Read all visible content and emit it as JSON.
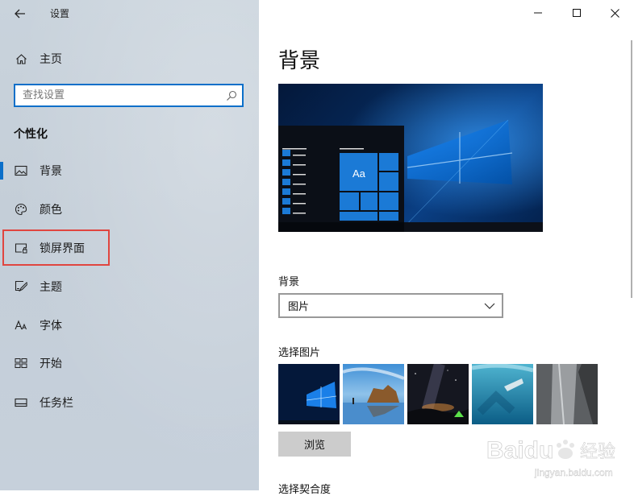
{
  "window": {
    "title": "设置"
  },
  "sidebar": {
    "home_label": "主页",
    "search_placeholder": "查找设置",
    "section_title": "个性化",
    "items": [
      {
        "label": "背景",
        "icon": "picture-icon",
        "selected": true
      },
      {
        "label": "颜色",
        "icon": "palette-icon"
      },
      {
        "label": "锁屏界面",
        "icon": "lock-screen-icon",
        "highlighted": true
      },
      {
        "label": "主题",
        "icon": "theme-icon"
      },
      {
        "label": "字体",
        "icon": "font-icon"
      },
      {
        "label": "开始",
        "icon": "start-icon"
      },
      {
        "label": "任务栏",
        "icon": "taskbar-icon"
      }
    ]
  },
  "main": {
    "page_title": "背景",
    "preview_tile_text": "Aa",
    "background_label": "背景",
    "background_value": "图片",
    "choose_picture_label": "选择图片",
    "browse_label": "浏览",
    "choose_fit_label": "选择契合度"
  },
  "watermark": {
    "brand": "Baidu",
    "brand_cn": "经验",
    "url": "jingyan.baidu.com"
  },
  "colors": {
    "accent": "#0b6fc9",
    "highlight_box": "#e0453f",
    "sidebar_bg": "#c6d0da",
    "button_bg": "#cccccc"
  }
}
